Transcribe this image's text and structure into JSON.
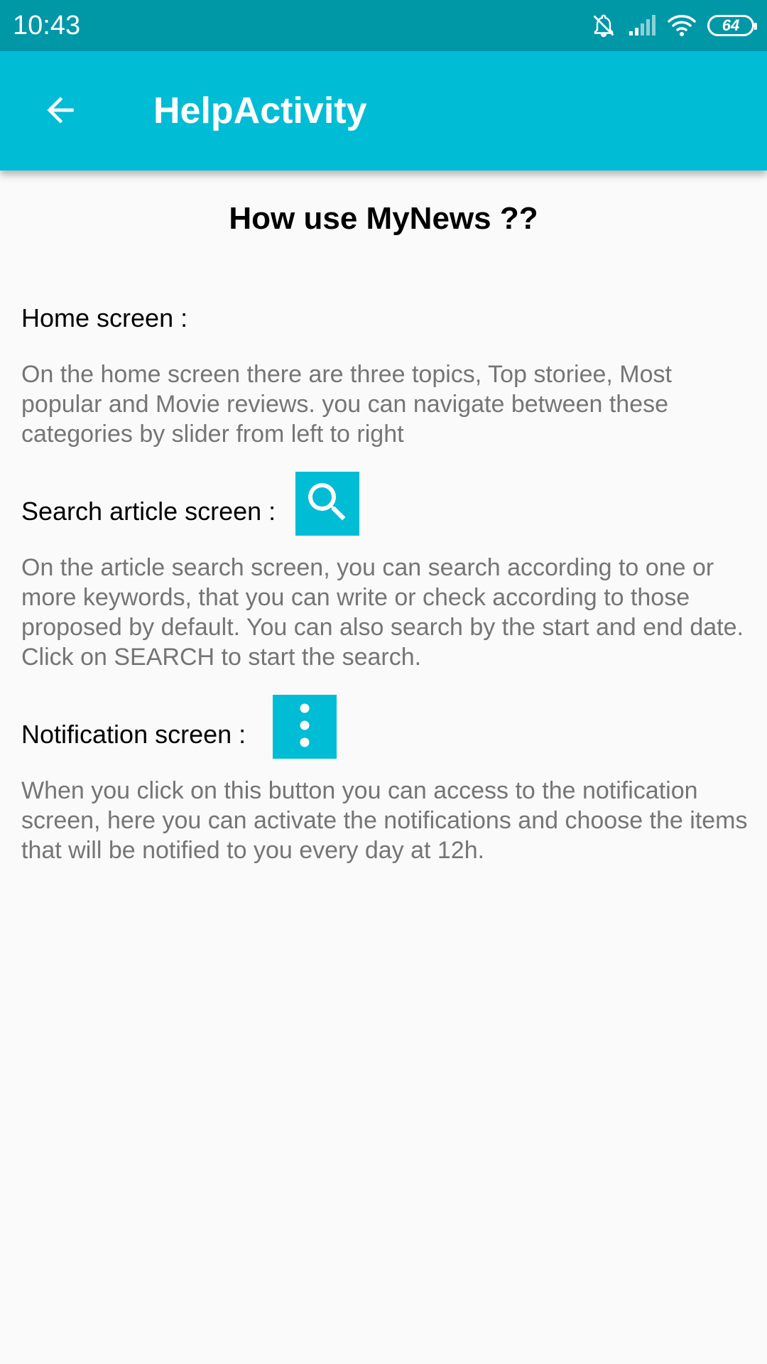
{
  "status_bar": {
    "time": "10:43",
    "battery": "64",
    "icons": [
      "mute-icon",
      "signal-icon",
      "wifi-icon",
      "battery-icon"
    ]
  },
  "app_bar": {
    "title": "HelpActivity",
    "back_icon": "arrow-back-icon",
    "color": "#00bcd4",
    "status_color": "#0097a7"
  },
  "main": {
    "heading": "How use MyNews ??",
    "sections": [
      {
        "label": "Home screen :",
        "text": "On the home screen there are three topics, Top storiee, Most popular and Movie reviews. you can navigate between these categories by slider from left to right"
      },
      {
        "label": "Search article screen :",
        "icon": "search-icon",
        "text": "On the article search screen, you can search according to one or more keywords, that you can write or check according to those proposed by default. You can also search by the start and end date. Click on SEARCH to start the search."
      },
      {
        "label": "Notification screen :",
        "icon": "more-vertical-icon",
        "text": "When you click on this button you can access to the notification screen, here you can activate the notifications and choose the items that will be notified to you every day at 12h."
      }
    ]
  }
}
